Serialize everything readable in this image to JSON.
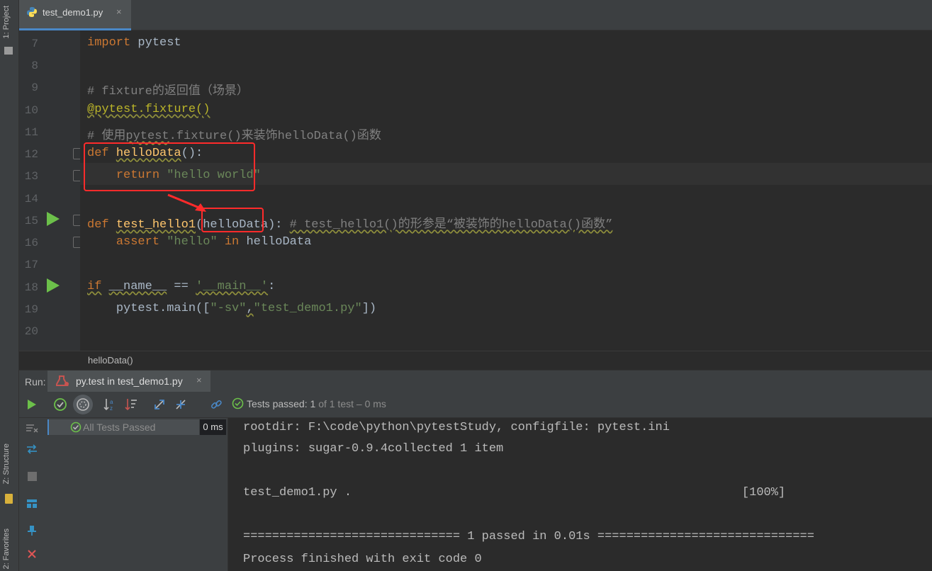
{
  "tool_windows": {
    "project": "1: Project",
    "structure": "Z: Structure",
    "favorites": "2: Favorites"
  },
  "editor_tab": {
    "filename": "test_demo1.py",
    "close": "×",
    "icon": "python-file-icon"
  },
  "code": {
    "lines": [
      {
        "n": "7"
      },
      {
        "n": "8"
      },
      {
        "n": "9"
      },
      {
        "n": "10"
      },
      {
        "n": "11"
      },
      {
        "n": "12"
      },
      {
        "n": "13"
      },
      {
        "n": "14"
      },
      {
        "n": "15"
      },
      {
        "n": "16"
      },
      {
        "n": "17"
      },
      {
        "n": "18"
      },
      {
        "n": "19"
      },
      {
        "n": "20"
      }
    ],
    "l7_kw": "import",
    "l7_rest": " pytest",
    "l9": "# fixture的返回值（场景）",
    "l10": "@pytest.fixture()",
    "l11_a": "# 使用",
    "l11_b": "pytest",
    "l11_c": ".fixture()来装饰helloData()函数",
    "l12_kw": "def",
    "l12_fn": "helloData",
    "l12_rest": "():",
    "l13_kw": "return",
    "l13_str": "\"hello world\"",
    "l15_kw": "def",
    "l15_fn": "test_hello1",
    "l15_paren": "(",
    "l15_param": "helloData",
    "l15_close": "):",
    "l15_com": "# test_hello1()的形参是“被装饰的helloData()函数”",
    "l16_kw": "assert",
    "l16_str": "\"hello\"",
    "l16_in": "in",
    "l16_rest": "helloData",
    "l18_kw": "if",
    "l18_name": "__name__",
    "l18_eq": " == ",
    "l18_str": "'__main__'",
    "l18_colon": ":",
    "l19_a": "pytest.main([",
    "l19_s1": "\"-sv\"",
    "l19_comma": ",",
    "l19_s2": "\"test_demo1.py\"",
    "l19_end": "])"
  },
  "breadcrumb": "helloData()",
  "run": {
    "label": "Run:",
    "tab_label": "py.test in test_demo1.py",
    "tab_close": "×",
    "status_prefix": "Tests passed:",
    "status_count": "1",
    "status_of": "of 1 test",
    "status_time": "– 0 ms"
  },
  "tree": {
    "label": "All Tests Passed",
    "time": "0 ms"
  },
  "console": {
    "lines": [
      "rootdir: F:\\code\\python\\pytestStudy, configfile: pytest.ini",
      "plugins: sugar-0.9.4collected 1 item",
      "",
      "test_demo1.py .                                                      [100%]",
      "",
      "============================== 1 passed in 0.01s ==============================",
      "Process finished with exit code 0"
    ]
  },
  "colors": {
    "accent": "#4a88c7",
    "run_green": "#6cc04a",
    "highlight_red": "#ff2b2b"
  }
}
